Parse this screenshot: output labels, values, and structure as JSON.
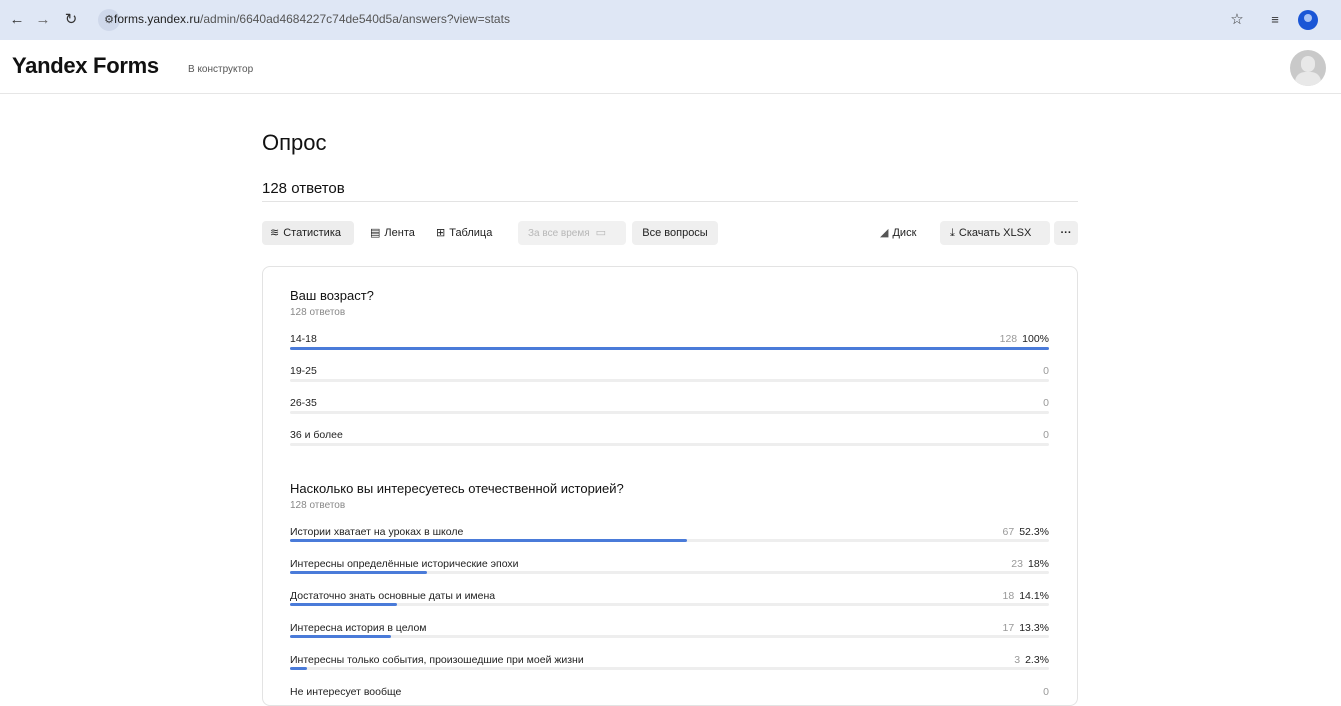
{
  "browser": {
    "url_host": "forms.yandex.ru",
    "url_path": "/admin/6640ad4684227c74de540d5a/answers?view=stats",
    "icons": [
      "back-arrow-icon",
      "forward-arrow-icon",
      "reload-icon",
      "site-info-icon",
      "bookmark-star-icon",
      "reading-list-icon",
      "profile-icon"
    ]
  },
  "header": {
    "brand": "Yandex Forms",
    "constructor_link": "В конструктор"
  },
  "page": {
    "title": "Опрос",
    "answers_count": "128 ответов"
  },
  "toolbar": {
    "stats": "Статистика",
    "feed": "Лента",
    "table": "Таблица",
    "period": "За все время",
    "questions": "Все вопросы",
    "disk": "Диск",
    "download": "Скачать XLSX",
    "more": "···"
  },
  "questions": [
    {
      "title": "Ваш возраст?",
      "subtitle": "128 ответов",
      "options": [
        {
          "label": "14-18",
          "count": "128",
          "percent": "100%",
          "fraction": 1.0
        },
        {
          "label": "19-25",
          "count": "0",
          "percent": "",
          "fraction": 0
        },
        {
          "label": "26-35",
          "count": "0",
          "percent": "",
          "fraction": 0
        },
        {
          "label": "36 и более",
          "count": "0",
          "percent": "",
          "fraction": 0
        }
      ]
    },
    {
      "title": "Насколько вы интересуетесь отечественной историей?",
      "subtitle": "128 ответов",
      "options": [
        {
          "label": "Истории хватает на уроках в школе",
          "count": "67",
          "percent": "52.3%",
          "fraction": 0.523
        },
        {
          "label": "Интересны определённые исторические эпохи",
          "count": "23",
          "percent": "18%",
          "fraction": 0.18
        },
        {
          "label": "Достаточно знать основные даты и имена",
          "count": "18",
          "percent": "14.1%",
          "fraction": 0.141
        },
        {
          "label": "Интересна история в целом",
          "count": "17",
          "percent": "13.3%",
          "fraction": 0.133
        },
        {
          "label": "Интересны только события, произошедшие при моей жизни",
          "count": "3",
          "percent": "2.3%",
          "fraction": 0.023
        },
        {
          "label": "Не интересует вообще",
          "count": "0",
          "percent": "",
          "fraction": 0
        }
      ]
    }
  ],
  "colors": {
    "bar_fill": "#4a7bd9",
    "bar_track": "#eeeeee"
  }
}
